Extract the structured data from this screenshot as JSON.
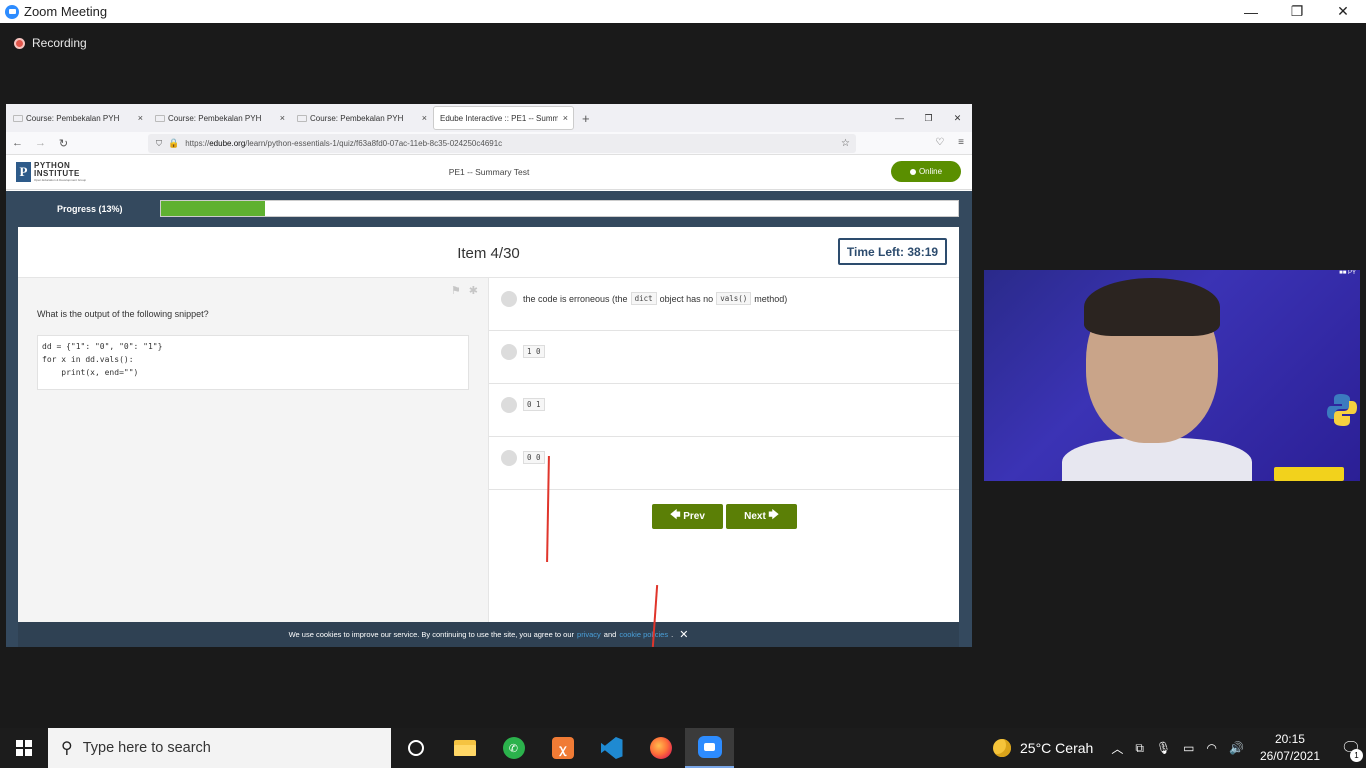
{
  "zoom": {
    "title": "Zoom Meeting",
    "recording_label": "Recording",
    "window_controls": [
      "—",
      "❐",
      "✕"
    ]
  },
  "browser": {
    "tabs": [
      {
        "label": "Course: Pembekalan PYH",
        "close": "×",
        "active": false
      },
      {
        "label": "Course: Pembekalan PYH",
        "close": "×",
        "active": false
      },
      {
        "label": "Course: Pembekalan PYH",
        "close": "×",
        "active": false
      },
      {
        "label": "Edube Interactive :: PE1 -- Summary",
        "close": "×",
        "active": true
      }
    ],
    "new_tab": "+",
    "url_prefix": "https://",
    "url_domain": "edube.org",
    "url_path": "/learn/python-essentials-1/quiz/f63a8fd0-07ac-11eb-8c35-024250c4691c"
  },
  "site": {
    "logo_line1": "PYTHON",
    "logo_line2": "INSTITUTE",
    "logo_line3": "Open Education & Development Group",
    "title": "PE1 -- Summary Test",
    "status": "Online"
  },
  "quiz": {
    "progress_label": "Progress (13%)",
    "progress_fraction": 0.13,
    "item_label": "Item 4/30",
    "time_left": "Time Left: 38:19",
    "question": "What is the output of the following snippet?",
    "code_lines": [
      "dd = {\"1\": \"0\", \"0\": \"1\"}",
      "for x in dd.vals():",
      "    print(x, end=\"\")"
    ],
    "answers": [
      {
        "pre": "the code is erroneous (the",
        "code1": "dict",
        "mid": "object has no",
        "code2": "vals()",
        "post": "method)"
      },
      {
        "code": "1 0"
      },
      {
        "code": "0 1"
      },
      {
        "code": "0 0"
      }
    ],
    "prev_label": "Prev",
    "next_label": "Next"
  },
  "cookie": {
    "text": "We use cookies to improve our service. By continuing to use the site, you agree to our",
    "link1": "privacy",
    "and": "and",
    "link2": "cookie policies",
    "end": ".",
    "close": "✕"
  },
  "webcam": {
    "tag": "■■ PY"
  },
  "taskbar": {
    "search_placeholder": "Type here to search",
    "weather": "25°C  Cerah",
    "time": "20:15",
    "date": "26/07/2021",
    "notif_count": "1"
  }
}
